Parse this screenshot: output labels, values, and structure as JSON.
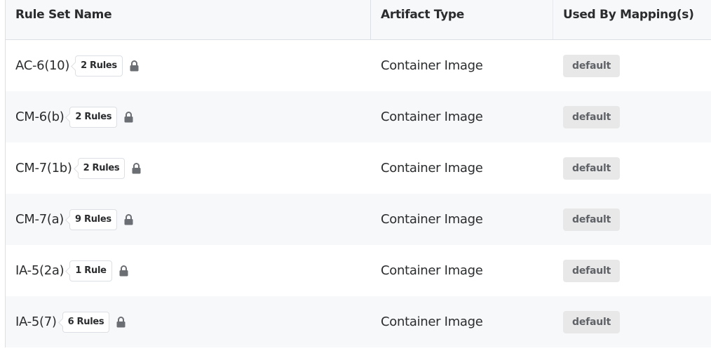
{
  "table": {
    "columns": [
      {
        "label": "Rule Set Name"
      },
      {
        "label": "Artifact Type"
      },
      {
        "label": "Used By Mapping(s)"
      }
    ],
    "rows": [
      {
        "name": "AC-6(10)",
        "rule_count": "2 Rules",
        "icon": "lock-icon",
        "artifact_type": "Container Image",
        "mapping": "default"
      },
      {
        "name": "CM-6(b)",
        "rule_count": "2 Rules",
        "icon": "lock-icon",
        "artifact_type": "Container Image",
        "mapping": "default"
      },
      {
        "name": "CM-7(1b)",
        "rule_count": "2 Rules",
        "icon": "lock-icon",
        "artifact_type": "Container Image",
        "mapping": "default"
      },
      {
        "name": "CM-7(a)",
        "rule_count": "9 Rules",
        "icon": "lock-icon",
        "artifact_type": "Container Image",
        "mapping": "default"
      },
      {
        "name": "IA-5(2a)",
        "rule_count": "1 Rule",
        "icon": "lock-icon",
        "artifact_type": "Container Image",
        "mapping": "default"
      },
      {
        "name": "IA-5(7)",
        "rule_count": "6 Rules",
        "icon": "lock-icon",
        "artifact_type": "Container Image",
        "mapping": "default"
      }
    ]
  },
  "colors": {
    "header_bg": "#f7f8fa",
    "alt_row_bg": "#f7f8fa",
    "mapping_badge_bg": "#e8e8e8",
    "lock_icon": "#6b6e72"
  }
}
